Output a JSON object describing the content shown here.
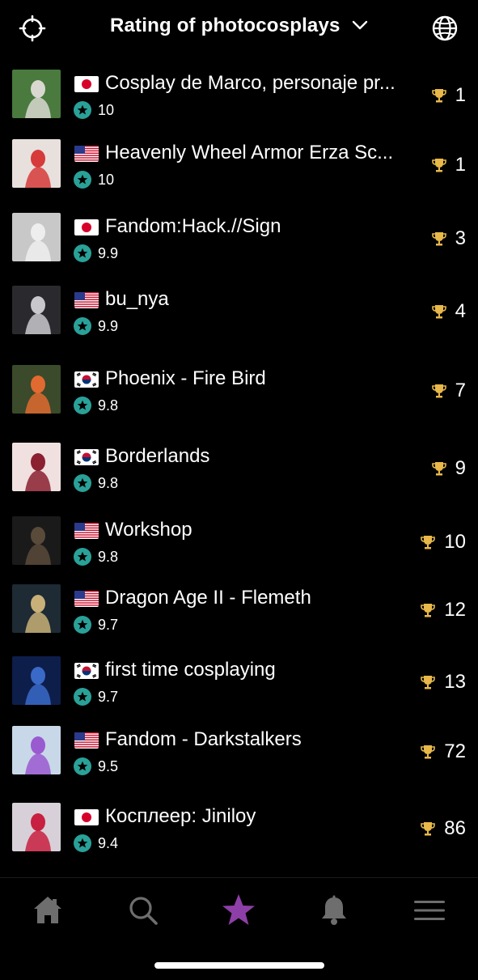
{
  "header": {
    "title": "Rating of photocosplays",
    "left_icon": "crosshair-icon",
    "right_icon": "globe-icon"
  },
  "colors": {
    "star_badge": "#2aa198",
    "trophy": "#e8b84a",
    "active_tab": "#8e3fa7",
    "inactive_tab": "#6e6e6e"
  },
  "items": [
    {
      "flag": "jp",
      "name": "Cosplay de Marco, personaje pr...",
      "score": "10",
      "rank": "1"
    },
    {
      "flag": "us",
      "name": "Heavenly Wheel Armor Erza Sc...",
      "score": "10",
      "rank": "1"
    },
    {
      "flag": "jp",
      "name": "Fandom:Hack.//Sign",
      "score": "9.9",
      "rank": "3"
    },
    {
      "flag": "us",
      "name": "bu_nya",
      "score": "9.9",
      "rank": "4"
    },
    {
      "flag": "kr",
      "name": "Phoenix - Fire Bird",
      "score": "9.8",
      "rank": "7"
    },
    {
      "flag": "kr",
      "name": "Borderlands",
      "score": "9.8",
      "rank": "9"
    },
    {
      "flag": "us",
      "name": "Workshop",
      "score": "9.8",
      "rank": "10"
    },
    {
      "flag": "us",
      "name": "Dragon Age II - Flemeth",
      "score": "9.7",
      "rank": "12"
    },
    {
      "flag": "kr",
      "name": "first time cosplaying",
      "score": "9.7",
      "rank": "13"
    },
    {
      "flag": "us",
      "name": "Fandom - Darkstalkers",
      "score": "9.5",
      "rank": "72"
    },
    {
      "flag": "jp",
      "name": "Косплеер: Jiniloy",
      "score": "9.4",
      "rank": "86"
    }
  ],
  "tabbar": [
    {
      "icon": "home-icon",
      "active": false
    },
    {
      "icon": "search-icon",
      "active": false
    },
    {
      "icon": "star-icon",
      "active": true
    },
    {
      "icon": "bell-icon",
      "active": false
    },
    {
      "icon": "menu-icon",
      "active": false
    }
  ]
}
